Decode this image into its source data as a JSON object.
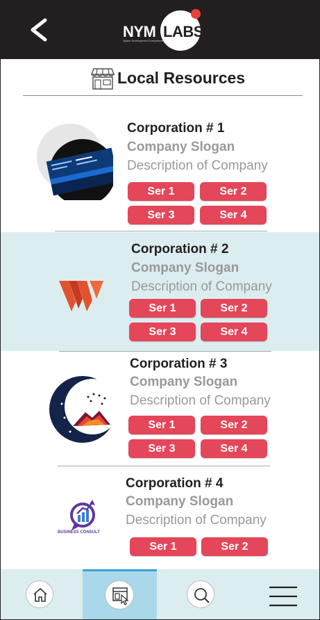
{
  "header": {
    "logo_left": "NYM",
    "logo_right": "LABS",
    "logo_tagline": "Space Development Everywhere",
    "back_icon": "chevron-left-icon"
  },
  "page": {
    "title": "Local Resources",
    "title_icon": "storefront-icon"
  },
  "companies": [
    {
      "name": "Corporation # 1",
      "slogan": "Company Slogan",
      "description": "Description of Company",
      "logo": "business-card-logo",
      "services": [
        "Ser 1",
        "Ser 2",
        "Ser 3",
        "Ser 4"
      ]
    },
    {
      "name": "Corporation # 2",
      "slogan": "Company Slogan",
      "description": "Description of Company",
      "logo": "w-letter-logo",
      "services": [
        "Ser 1",
        "Ser 2",
        "Ser 3",
        "Ser 4"
      ]
    },
    {
      "name": "Corporation # 3",
      "slogan": "Company Slogan",
      "description": "Description of Company",
      "logo": "moon-mountain-logo",
      "services": [
        "Ser 1",
        "Ser 2",
        "Ser 3",
        "Ser 4"
      ]
    },
    {
      "name": "Corporation # 4",
      "slogan": "Company Slogan",
      "description": "Description of Company",
      "logo": "business-consult-logo",
      "logo_text": "BUSINESS CONSULT",
      "services": [
        "Ser 1",
        "Ser 2"
      ]
    }
  ],
  "nav": {
    "items": [
      "home-icon",
      "directory-icon",
      "search-icon",
      "menu-icon"
    ],
    "active": "directory-icon"
  },
  "colors": {
    "header_bg": "#231f20",
    "accent": "#e4465a",
    "alt_row": "#dcedf0",
    "nav_active": "#a9d8ea",
    "logo_dot": "#e8413c"
  }
}
